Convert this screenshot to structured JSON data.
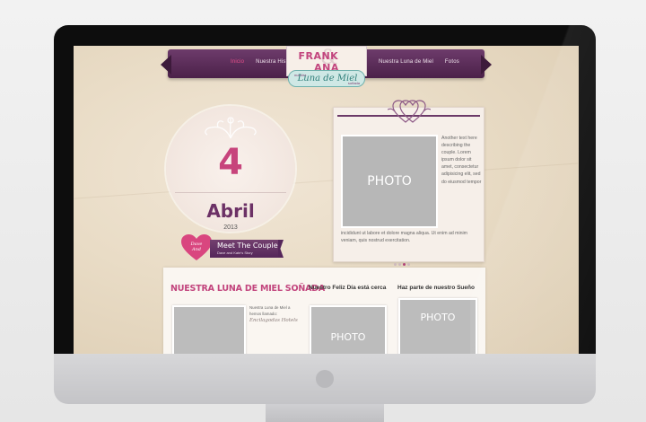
{
  "site": {
    "nav_left": [
      "Inicio",
      "Nuestra Historia"
    ],
    "nav_right": [
      "Nuestra Luna de Miel",
      "Fotos"
    ],
    "active_nav": "Inicio",
    "logo": {
      "name_left": "FRANK",
      "name_right": "ANA",
      "script": "Luna de Miel",
      "small_top": "nuestra",
      "small_bottom": "soñada"
    }
  },
  "countdown": {
    "day": "4",
    "month": "Abril",
    "year": "2013"
  },
  "meet": {
    "heart_line1": "Dave",
    "heart_line2": "And",
    "title": "Meet The Couple",
    "subtitle": "Dave and Kate's Story"
  },
  "featured": {
    "photo_label": "PHOTO",
    "side_text": "Another text here describing the couple. Lorem ipsum dolor sit amet, consectetur adipisicing elit, sed do eiusmod tempor",
    "bottom_text": "incididunt ut labore et dolore magna aliqua. Ut enim ad minim veniam, quis nostrud exercitation.",
    "dots": 4,
    "active_dot": 3
  },
  "bottom": {
    "heading_main": "NUESTRA LUNA DE MIEL SOÑADA",
    "heading_a": "Nuestro Feliz Día está cerca",
    "heading_b": "Haz parte de nuestro Sueño",
    "photo_label": "PHOTO",
    "snippet": "Nuestra Luna de Miel a hemos llamado:",
    "signature": "Encilagodas Hotels"
  },
  "colors": {
    "accent_pink": "#c2447d",
    "ribbon_purple": "#5a2a58",
    "teal": "#2f7f7a"
  }
}
